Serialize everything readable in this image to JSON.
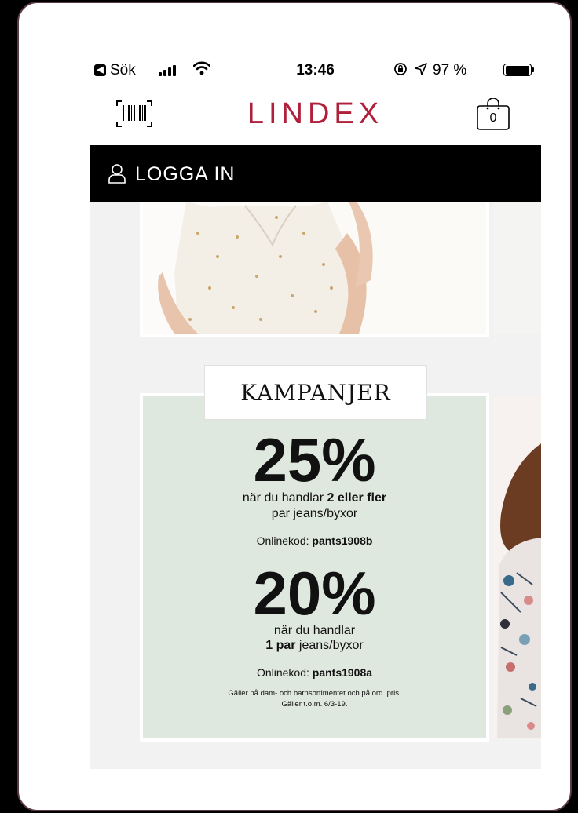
{
  "status_bar": {
    "back_label": "Sök",
    "time": "13:46",
    "battery_percent": "97 %",
    "battery_level": 0.97
  },
  "header": {
    "logo": "LINDEX",
    "bag_count": "0"
  },
  "nav": {
    "login_label": "LOGGA IN"
  },
  "campaign": {
    "heading": "KAMPANJER",
    "offer1": {
      "percent": "25%",
      "line1_pre": "när du handlar ",
      "line1_bold": "2 eller fler",
      "line2": "par jeans/byxor",
      "code_label": "Onlinekod: ",
      "code": "pants1908b"
    },
    "offer2": {
      "percent": "20%",
      "line1": "när du handlar",
      "line2_bold": "1 par",
      "line2_post": " jeans/byxor",
      "code_label": "Onlinekod: ",
      "code": "pants1908a"
    },
    "fine_print_1": "Gäller på dam- och barnsortimentet och på ord. pris.",
    "fine_print_2": "Gäller t.o.m. 6/3-19."
  },
  "colors": {
    "brand": "#b0203a",
    "promo_bg": "#dfe8df",
    "nav_bg": "#000000"
  }
}
